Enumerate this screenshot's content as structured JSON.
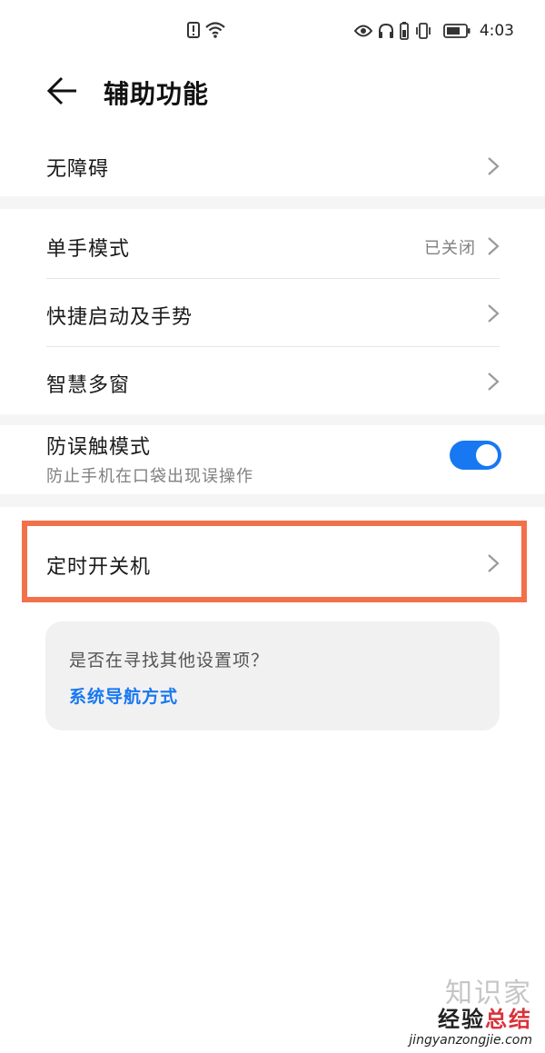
{
  "status_bar": {
    "time": "4:03",
    "icons": [
      "alert-icon",
      "wifi-icon",
      "eye-icon",
      "headphone-icon",
      "battery-small-icon",
      "vibrate-icon",
      "battery-icon"
    ]
  },
  "header": {
    "title": "辅助功能",
    "back_icon": "back-arrow-icon"
  },
  "rows": {
    "accessibility": {
      "label": "无障碍"
    },
    "one_hand": {
      "label": "单手模式",
      "value": "已关闭"
    },
    "quick_launch": {
      "label": "快捷启动及手势"
    },
    "smart_multiwindow": {
      "label": "智慧多窗"
    },
    "mistouch": {
      "label": "防误触模式",
      "description": "防止手机在口袋出现误操作",
      "toggle_on": true
    },
    "scheduled_power": {
      "label": "定时开关机"
    }
  },
  "suggestion_card": {
    "question": "是否在寻找其他设置项？",
    "link": "系统导航方式"
  },
  "watermark": {
    "big_text": "知识家",
    "title_part1": "经验",
    "title_part2": "总结",
    "url": "jingyanzongjie.com"
  },
  "colors": {
    "accent": "#1778f2",
    "highlight": "#f2714a",
    "section_gap": "#f5f5f5"
  }
}
